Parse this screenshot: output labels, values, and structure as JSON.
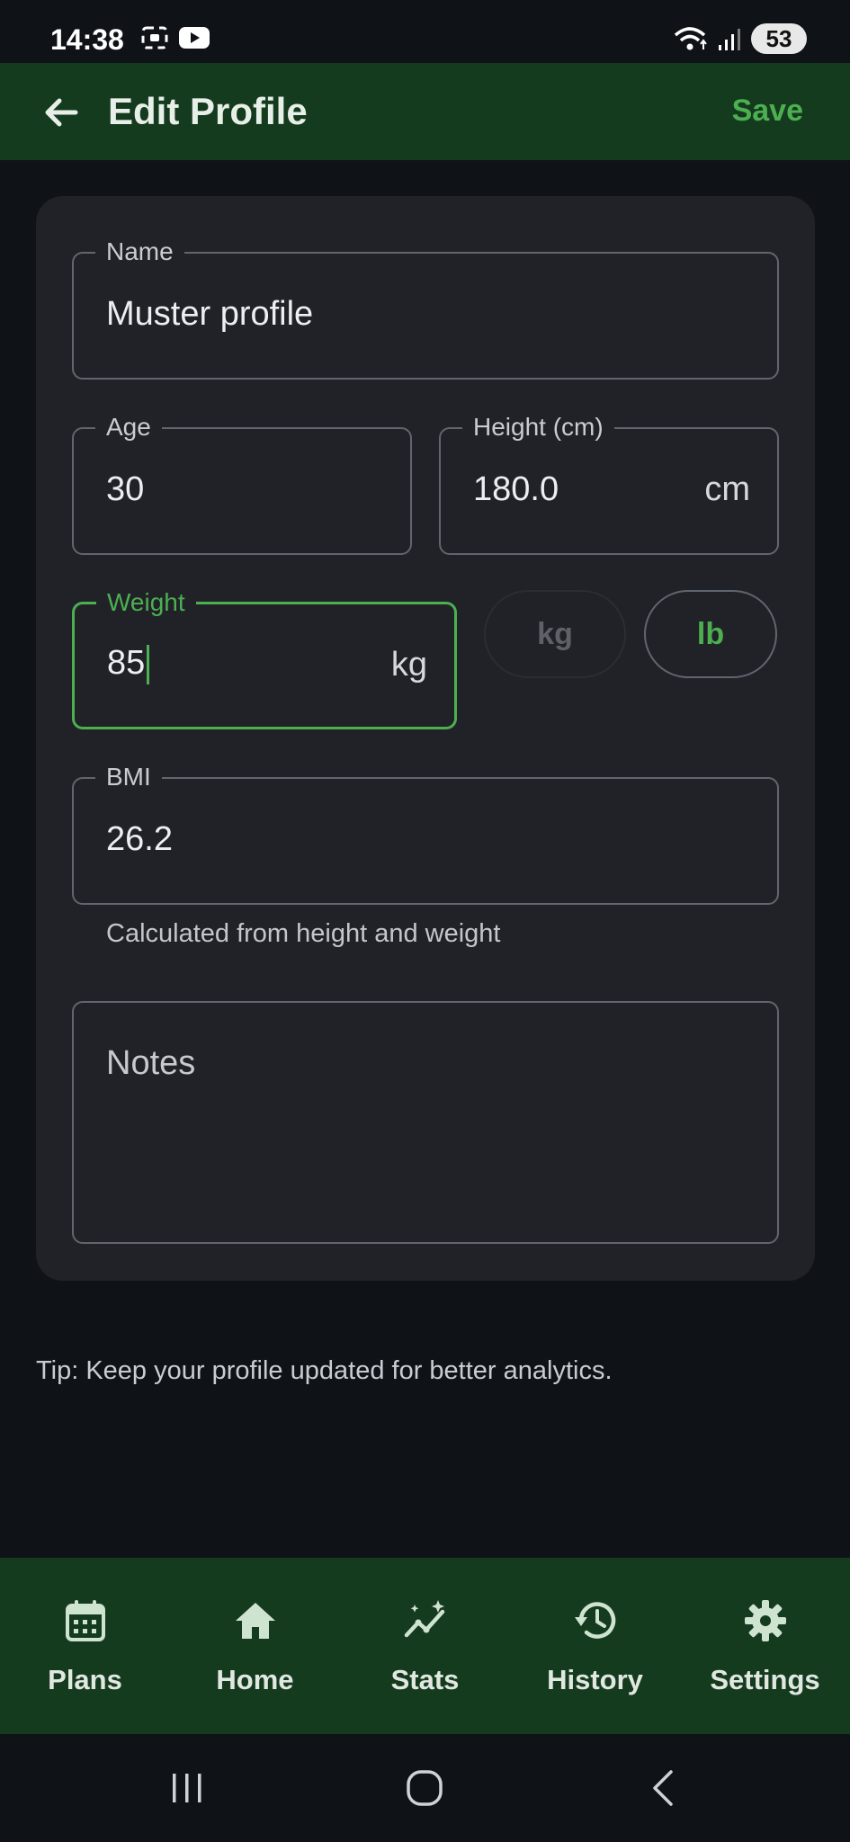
{
  "status_bar": {
    "time": "14:38",
    "battery": "53",
    "icons": [
      "screenshot-icon",
      "youtube-icon",
      "wifi-icon",
      "signal-icon",
      "battery-icon"
    ]
  },
  "app_bar": {
    "title": "Edit Profile",
    "save_label": "Save",
    "back_icon": "arrow-back-icon"
  },
  "form": {
    "name": {
      "label": "Name",
      "value": "Muster profile"
    },
    "age": {
      "label": "Age",
      "value": "30"
    },
    "height": {
      "label": "Height (cm)",
      "value": "180.0",
      "suffix": "cm"
    },
    "weight": {
      "label": "Weight",
      "value": "85",
      "suffix": "kg"
    },
    "units": {
      "kg": "kg",
      "lb": "lb",
      "selected": "lb"
    },
    "bmi": {
      "label": "BMI",
      "value": "26.2",
      "helper": "Calculated from height and weight"
    },
    "notes": {
      "placeholder": "Notes"
    }
  },
  "tip": "Tip: Keep your profile updated for better analytics.",
  "bottom_nav": {
    "items": [
      {
        "label": "Plans",
        "icon": "calendar-icon"
      },
      {
        "label": "Home",
        "icon": "home-icon"
      },
      {
        "label": "Stats",
        "icon": "stats-icon"
      },
      {
        "label": "History",
        "icon": "history-icon"
      },
      {
        "label": "Settings",
        "icon": "gear-icon"
      }
    ]
  },
  "colors": {
    "accent": "#4caf50",
    "app_bar": "#153b1f",
    "background": "#0f1318",
    "card": "#212228"
  }
}
